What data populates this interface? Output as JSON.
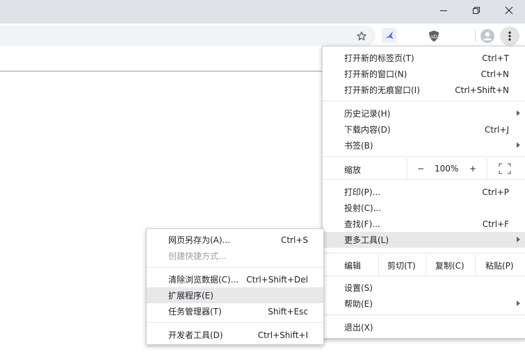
{
  "window": {
    "minimize_icon": "minimize-icon",
    "restore_icon": "restore-icon",
    "close_icon": "close-icon"
  },
  "toolbar": {
    "star_icon": "star-icon",
    "extension_icons": [
      "bird-extension-icon",
      "ublock-icon"
    ],
    "ublock_label": "uD",
    "profile_icon": "profile-avatar-icon",
    "menu_icon": "kebab-menu-icon"
  },
  "main_menu": {
    "new_tab": {
      "label": "打开新的标签页(T)",
      "shortcut": "Ctrl+T"
    },
    "new_window": {
      "label": "打开新的窗口(N)",
      "shortcut": "Ctrl+N"
    },
    "new_incognito": {
      "label": "打开新的无痕窗口(I)",
      "shortcut": "Ctrl+Shift+N"
    },
    "history": {
      "label": "历史记录(H)"
    },
    "downloads": {
      "label": "下载内容(D)",
      "shortcut": "Ctrl+J"
    },
    "bookmarks": {
      "label": "书签(B)"
    },
    "zoom": {
      "label": "缩放",
      "minus": "−",
      "value": "100%",
      "plus": "+"
    },
    "print": {
      "label": "打印(P)...",
      "shortcut": "Ctrl+P"
    },
    "cast": {
      "label": "投射(C)..."
    },
    "find": {
      "label": "查找(F)...",
      "shortcut": "Ctrl+F"
    },
    "more_tools": {
      "label": "更多工具(L)"
    },
    "edit": {
      "label": "编辑",
      "cut": "剪切(T)",
      "copy": "复制(C)",
      "paste": "粘贴(P)"
    },
    "settings": {
      "label": "设置(S)"
    },
    "help": {
      "label": "帮助(E)"
    },
    "exit": {
      "label": "退出(X)"
    }
  },
  "sub_menu": {
    "save_page": {
      "label": "网页另存为(A)...",
      "shortcut": "Ctrl+S"
    },
    "create_shortcut": {
      "label": "创建快捷方式..."
    },
    "clear_data": {
      "label": "清除浏览数据(C)...",
      "shortcut": "Ctrl+Shift+Del"
    },
    "extensions": {
      "label": "扩展程序(E)"
    },
    "task_manager": {
      "label": "任务管理器(T)",
      "shortcut": "Shift+Esc"
    },
    "dev_tools": {
      "label": "开发者工具(D)",
      "shortcut": "Ctrl+Shift+I"
    }
  },
  "colors": {
    "titlebar": "#dee1e6",
    "omnibox": "#f1f3f4",
    "highlight": "#e8e8e9",
    "ublock": "#800000",
    "bird": "#4a6cf7"
  }
}
